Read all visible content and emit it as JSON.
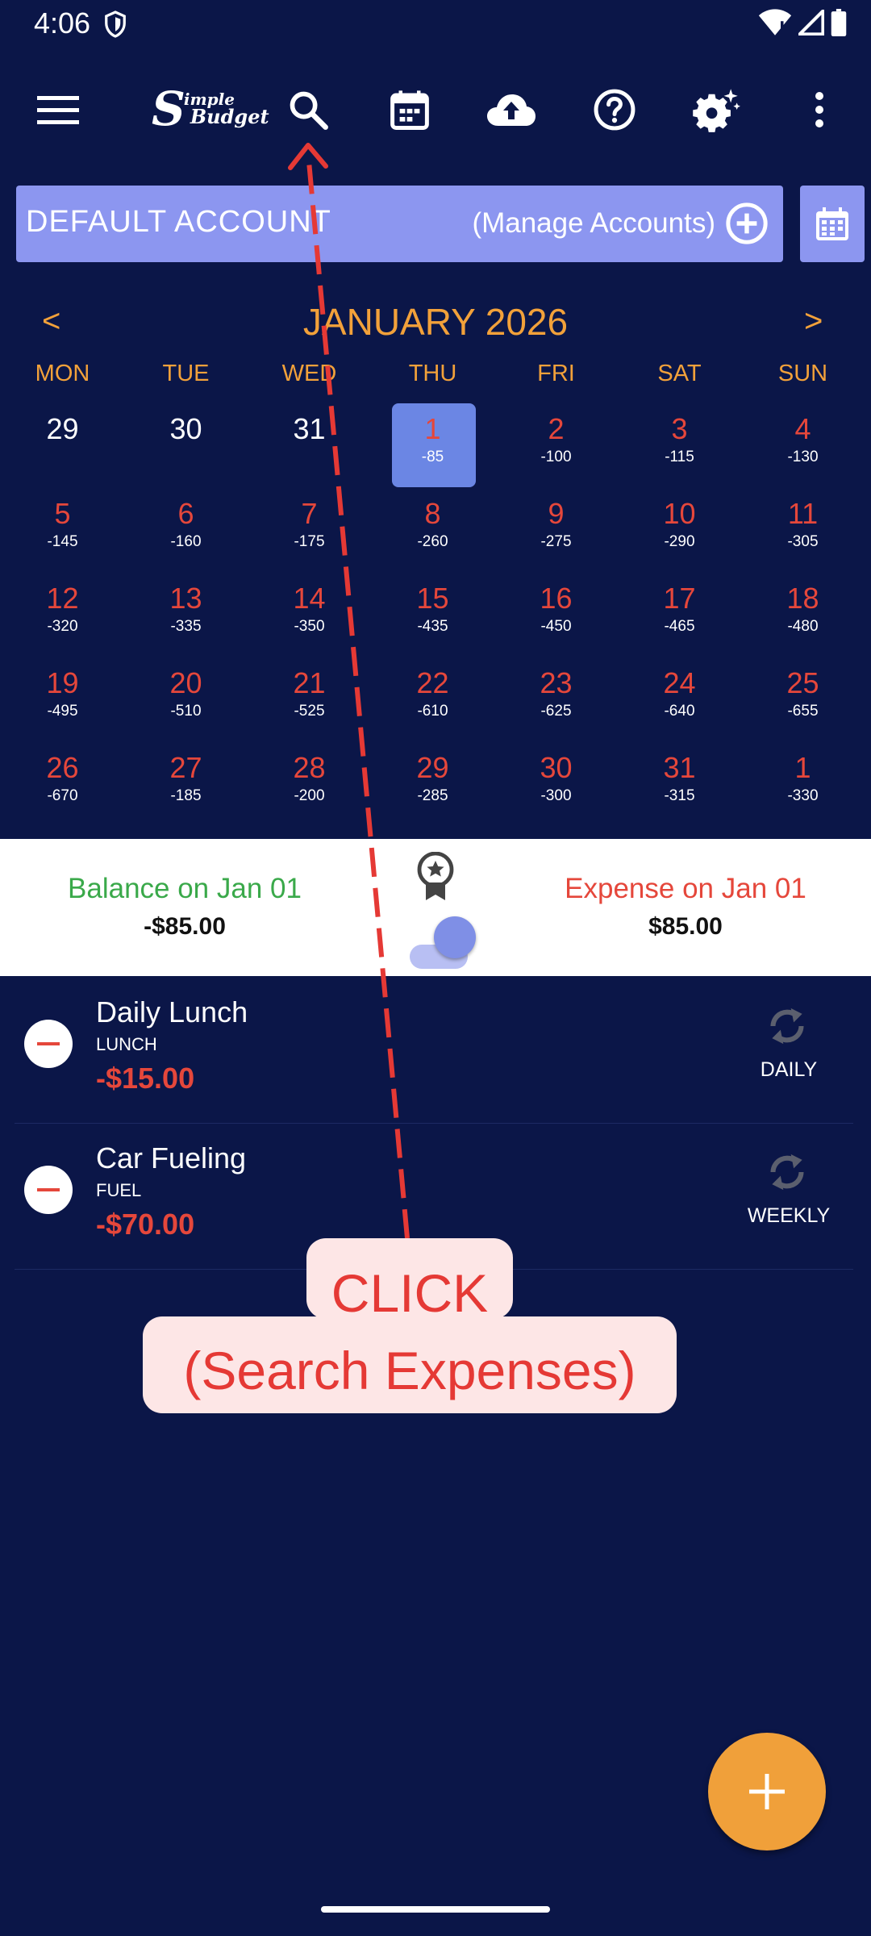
{
  "status_bar": {
    "time": "4:06"
  },
  "toolbar": {
    "logo_big": "S",
    "logo_line1": "imple",
    "logo_line2": "Budget",
    "icons": [
      "menu-icon",
      "search-icon",
      "calendar-icon",
      "cloud-upload-icon",
      "help-icon",
      "settings-icon",
      "more-vert-icon"
    ]
  },
  "account": {
    "name": "DEFAULT ACCOUNT",
    "manage_label": "(Manage Accounts)"
  },
  "calendar": {
    "month_label": "JANUARY 2026",
    "prev": "<",
    "next": ">",
    "weekdays": [
      "MON",
      "TUE",
      "WED",
      "THU",
      "FRI",
      "SAT",
      "SUN"
    ],
    "weeks": [
      [
        {
          "d": "29",
          "a": ""
        },
        {
          "d": "30",
          "a": ""
        },
        {
          "d": "31",
          "a": ""
        },
        {
          "d": "1",
          "a": "-85"
        },
        {
          "d": "2",
          "a": "-100"
        },
        {
          "d": "3",
          "a": "-115"
        },
        {
          "d": "4",
          "a": "-130"
        }
      ],
      [
        {
          "d": "5",
          "a": "-145"
        },
        {
          "d": "6",
          "a": "-160"
        },
        {
          "d": "7",
          "a": "-175"
        },
        {
          "d": "8",
          "a": "-260"
        },
        {
          "d": "9",
          "a": "-275"
        },
        {
          "d": "10",
          "a": "-290"
        },
        {
          "d": "11",
          "a": "-305"
        }
      ],
      [
        {
          "d": "12",
          "a": "-320"
        },
        {
          "d": "13",
          "a": "-335"
        },
        {
          "d": "14",
          "a": "-350"
        },
        {
          "d": "15",
          "a": "-435"
        },
        {
          "d": "16",
          "a": "-450"
        },
        {
          "d": "17",
          "a": "-465"
        },
        {
          "d": "18",
          "a": "-480"
        }
      ],
      [
        {
          "d": "19",
          "a": "-495"
        },
        {
          "d": "20",
          "a": "-510"
        },
        {
          "d": "21",
          "a": "-525"
        },
        {
          "d": "22",
          "a": "-610"
        },
        {
          "d": "23",
          "a": "-625"
        },
        {
          "d": "24",
          "a": "-640"
        },
        {
          "d": "25",
          "a": "-655"
        }
      ],
      [
        {
          "d": "26",
          "a": "-670"
        },
        {
          "d": "27",
          "a": "-185"
        },
        {
          "d": "28",
          "a": "-200"
        },
        {
          "d": "29",
          "a": "-285"
        },
        {
          "d": "30",
          "a": "-300"
        },
        {
          "d": "31",
          "a": "-315"
        },
        {
          "d": "1",
          "a": "-330"
        }
      ]
    ]
  },
  "summary": {
    "balance_label": "Balance on Jan 01",
    "balance_value": "-$85.00",
    "expense_label": "Expense on Jan 01",
    "expense_value": "$85.00"
  },
  "expenses": [
    {
      "title": "Daily Lunch",
      "category": "LUNCH",
      "amount": "-$15.00",
      "repeat": "DAILY"
    },
    {
      "title": "Car Fueling",
      "category": "FUEL",
      "amount": "-$70.00",
      "repeat": "WEEKLY"
    }
  ],
  "annotation": {
    "line1": "CLICK",
    "line2": "(Search Expenses)"
  },
  "colors": {
    "background": "#0b1648",
    "accent_orange": "#f2a13a",
    "expense_red": "#e5473b",
    "balance_green": "#3aa94a",
    "account_bar": "#8c96f0"
  }
}
